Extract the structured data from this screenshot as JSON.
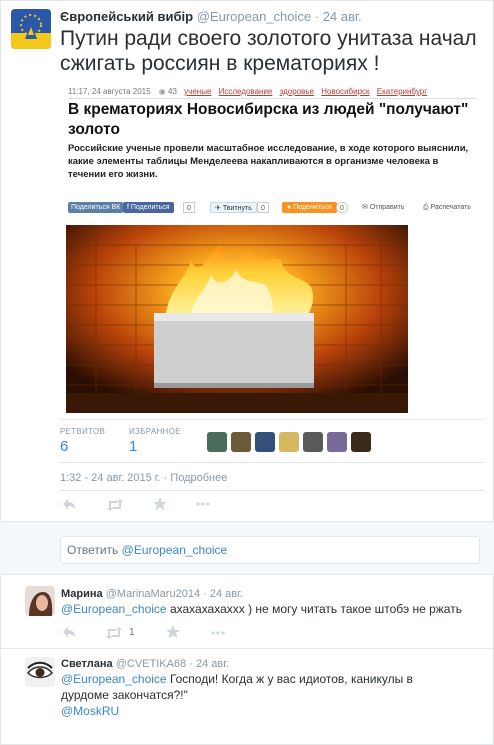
{
  "main_tweet": {
    "author_name": "Європейський вибір",
    "handle": "@European_choice",
    "separator": "·",
    "time": "24 авг.",
    "text": "Путин ради своего золотого унитаза начал сжигать россиян в крематориях !"
  },
  "article": {
    "date": "11:17, 24 августа 2015",
    "views": "43",
    "tags": [
      "ученые",
      "Исследование",
      "здоровье",
      "Новосибирск",
      "Екатеринбург"
    ],
    "title": "В крематориях Новосибирска из людей \"получают\" золото",
    "lead": "Российские ученые провели масштабное исследование, в ходе которого выяснили, какие элементы таблицы Менделеева накапливаются в организме человека в течении его жизни.",
    "share": {
      "vk": "Поделиться ВК",
      "facebook": "Поделиться",
      "facebook_count": "0",
      "twitter": "Твитнуть",
      "twitter_count": "0",
      "ok": "Поделиться",
      "ok_count": "0",
      "send": "Отправить",
      "print": "Распечатать"
    }
  },
  "stats": {
    "retweets_label": "РЕТВИТОВ",
    "retweets_value": "6",
    "favorites_label": "ИЗБРАННОЕ",
    "favorites_value": "1"
  },
  "timestamp": {
    "text": "1:32 - 24 авг. 2015 г.",
    "separator": "·",
    "details_link": "Подробнее"
  },
  "reply_box": {
    "prefix": "Ответить ",
    "mention": "@European_choice"
  },
  "replies": [
    {
      "name": "Марина",
      "handle": "@MarinaMaru2014",
      "separator": "·",
      "time": "24 авг.",
      "mention": "@European_choice",
      "text": "ахахахахаххх ) не могу читать такое штобэ не ржать",
      "retweet_count": "1"
    },
    {
      "name": "Светлана",
      "handle": "@CVETIKA68",
      "separator": "·",
      "time": "24 авг.",
      "mention": "@European_choice",
      "text": "Господи! Когда ж у вас идиотов, каникулы в дурдоме закончатся?!\"",
      "mention2": "@MoskRU"
    }
  ],
  "colors": {
    "link": "#3b88c3",
    "muted": "#8899a6",
    "border": "#e1e8ed",
    "accent_tag": "#c0392b"
  },
  "icons": [
    "reply-icon",
    "retweet-icon",
    "favorite-icon",
    "more-icon"
  ]
}
